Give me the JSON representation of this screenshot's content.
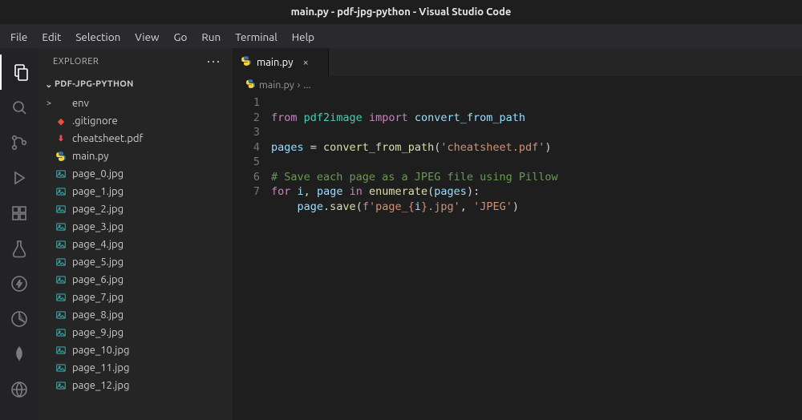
{
  "title": "main.py - pdf-jpg-python - Visual Studio Code",
  "menubar": [
    "File",
    "Edit",
    "Selection",
    "View",
    "Go",
    "Run",
    "Terminal",
    "Help"
  ],
  "activity_icons": [
    "files",
    "search",
    "scm",
    "run-debug",
    "extensions",
    "testing",
    "live",
    "unknown1",
    "unknown2",
    "unknown3"
  ],
  "sidebar": {
    "title": "EXPLORER",
    "more": "⋯",
    "folder": "PDF-JPG-PYTHON",
    "items": [
      {
        "icon": "folder",
        "label": "env",
        "chevron": ">"
      },
      {
        "icon": "git",
        "label": ".gitignore"
      },
      {
        "icon": "pdf",
        "label": "cheatsheet.pdf"
      },
      {
        "icon": "py",
        "label": "main.py"
      },
      {
        "icon": "img",
        "label": "page_0.jpg"
      },
      {
        "icon": "img",
        "label": "page_1.jpg"
      },
      {
        "icon": "img",
        "label": "page_2.jpg"
      },
      {
        "icon": "img",
        "label": "page_3.jpg"
      },
      {
        "icon": "img",
        "label": "page_4.jpg"
      },
      {
        "icon": "img",
        "label": "page_5.jpg"
      },
      {
        "icon": "img",
        "label": "page_6.jpg"
      },
      {
        "icon": "img",
        "label": "page_7.jpg"
      },
      {
        "icon": "img",
        "label": "page_8.jpg"
      },
      {
        "icon": "img",
        "label": "page_9.jpg"
      },
      {
        "icon": "img",
        "label": "page_10.jpg"
      },
      {
        "icon": "img",
        "label": "page_11.jpg"
      },
      {
        "icon": "img",
        "label": "page_12.jpg"
      }
    ]
  },
  "tab": {
    "label": "main.py",
    "close": "×"
  },
  "breadcrumb": {
    "file": "main.py",
    "sep": "›",
    "more": "..."
  },
  "code": {
    "line_numbers": [
      1,
      2,
      3,
      4,
      5,
      6,
      7
    ],
    "l1": {
      "from": "from",
      "mod": "pdf2image",
      "import": "import",
      "sym": "convert_from_path"
    },
    "l3": {
      "var": "pages",
      "eq": " = ",
      "fn": "convert_from_path",
      "paren_open": "(",
      "str": "'cheatsheet.pdf'",
      "paren_close": ")"
    },
    "l5": {
      "cmt": "# Save each page as a JPEG file using Pillow"
    },
    "l6": {
      "for": "for",
      "i": "i",
      "comma": ", ",
      "page": "page",
      "in": "in",
      "enum": "enumerate",
      "paren_open": "(",
      "arg": "pages",
      "paren_close_colon": "):"
    },
    "l7": {
      "indent": "    ",
      "obj": "page",
      "dot": ".",
      "save": "save",
      "paren_open": "(",
      "f": "f",
      "str1_open": "'page_{",
      "i": "i",
      "str1_close": "}.jpg'",
      "comma": ", ",
      "str2": "'JPEG'",
      "paren_close": ")"
    }
  }
}
